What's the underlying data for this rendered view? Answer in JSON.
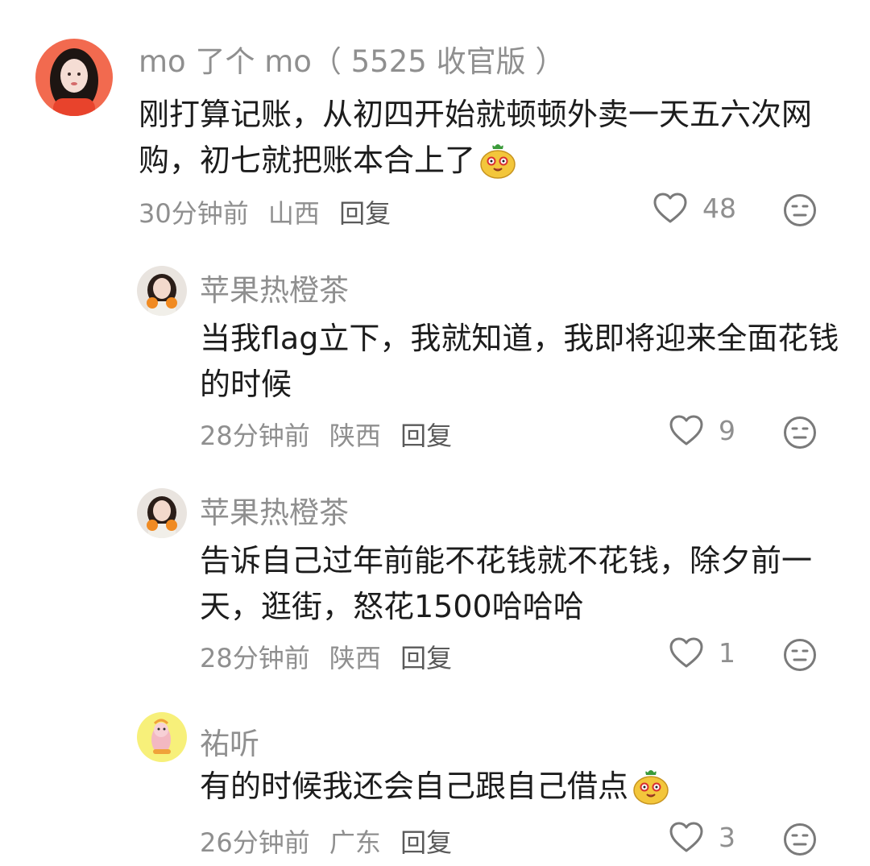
{
  "comments": [
    {
      "user": "mo 了个 mo（ 5525 收官版 ）",
      "text": "刚打算记账，从初四开始就顿顿外卖一天五六次网购，初七就把账本合上了",
      "time": "30分钟前",
      "location": "山西",
      "reply_label": "回复",
      "likes": "48",
      "avatar": "avatar-woman-red-sweater",
      "emoji": "mango-face-emoji"
    },
    {
      "user": "苹果热橙茶",
      "text": "当我flag立下，我就知道，我即将迎来全面花钱的时候",
      "time": "28分钟前",
      "location": "陕西",
      "reply_label": "回复",
      "likes": "9",
      "avatar": "avatar-girl-oranges"
    },
    {
      "user": "苹果热橙茶",
      "text": "告诉自己过年前能不花钱就不花钱，除夕前一天，逛街，怒花1500哈哈哈",
      "time": "28分钟前",
      "location": "陕西",
      "reply_label": "回复",
      "likes": "1",
      "avatar": "avatar-girl-oranges"
    },
    {
      "user": "祐听",
      "text": "有的时候我还会自己跟自己借点",
      "time": "26分钟前",
      "location": "广东",
      "reply_label": "回复",
      "likes": "3",
      "avatar": "avatar-cartoon-yellow",
      "emoji": "mango-face-emoji"
    }
  ],
  "icons": {
    "like": "heart-outline-icon",
    "dislike": "neutral-face-icon"
  },
  "colors": {
    "secondary_text": "#8f8f8f",
    "primary_text": "#1c1c1c",
    "icon": "#7a7a7a"
  }
}
